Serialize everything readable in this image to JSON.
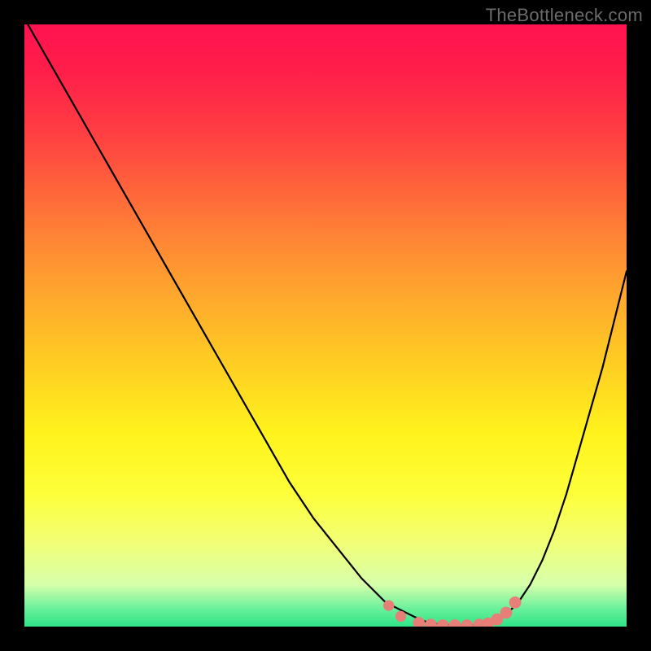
{
  "watermark": "TheBottleneck.com",
  "colors": {
    "background": "#000000",
    "curve": "#000000",
    "marker": "#e77f78",
    "watermark": "#6b6b6b"
  },
  "chart_data": {
    "type": "line",
    "title": "",
    "xlabel": "",
    "ylabel": "",
    "xlim": [
      0,
      100
    ],
    "ylim": [
      0,
      100
    ],
    "series": [
      {
        "name": "curve",
        "x": [
          0,
          4,
          8,
          12,
          16,
          20,
          24,
          28,
          32,
          36,
          40,
          44,
          48,
          52,
          56,
          60,
          62,
          64,
          66,
          68,
          70,
          72,
          74,
          76,
          78,
          80,
          82,
          84,
          86,
          88,
          90,
          92,
          94,
          96,
          98,
          100
        ],
        "y": [
          101,
          94,
          87,
          80,
          73,
          66,
          59,
          52,
          45,
          38,
          31,
          24,
          18,
          13,
          8,
          4,
          3,
          2,
          1,
          0.5,
          0.3,
          0.2,
          0.2,
          0.4,
          1,
          2,
          4,
          7,
          11,
          16,
          22,
          29,
          36,
          43,
          51,
          59
        ]
      }
    ],
    "markers": [
      {
        "x": 60.5,
        "y": 3.5,
        "r": 0.9
      },
      {
        "x": 62.5,
        "y": 1.7,
        "r": 0.9
      },
      {
        "x": 65.5,
        "y": 0.6,
        "r": 1.0
      },
      {
        "x": 67.5,
        "y": 0.3,
        "r": 1.0
      },
      {
        "x": 69.5,
        "y": 0.2,
        "r": 1.0
      },
      {
        "x": 71.5,
        "y": 0.2,
        "r": 1.0
      },
      {
        "x": 73.5,
        "y": 0.2,
        "r": 1.0
      },
      {
        "x": 75.5,
        "y": 0.3,
        "r": 1.0
      },
      {
        "x": 77.0,
        "y": 0.5,
        "r": 1.0
      },
      {
        "x": 78.5,
        "y": 1.2,
        "r": 1.0
      },
      {
        "x": 80.0,
        "y": 2.3,
        "r": 1.0
      },
      {
        "x": 81.5,
        "y": 4.0,
        "r": 1.0
      }
    ]
  }
}
